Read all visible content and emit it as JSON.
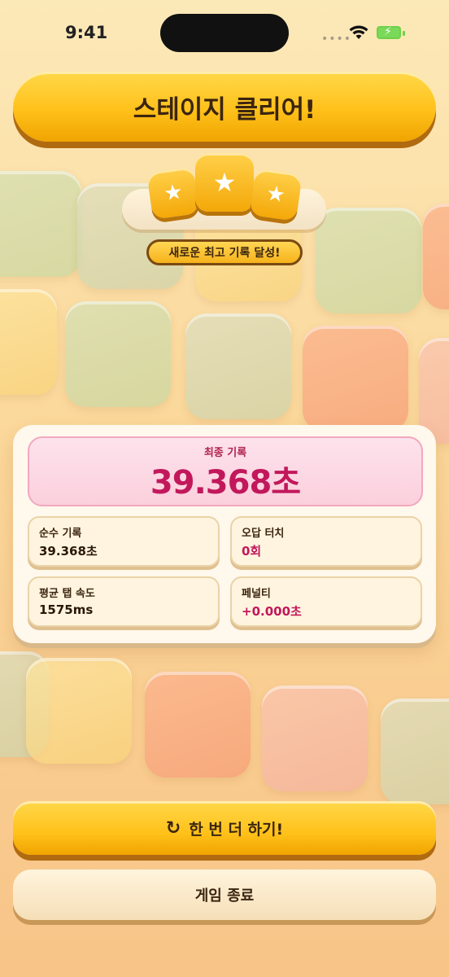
{
  "status": {
    "time": "9:41",
    "signal": "••••"
  },
  "banner": {
    "title": "스테이지 클리어!"
  },
  "stars": {
    "count": 3,
    "earned": 3,
    "glyph": "★"
  },
  "badge": {
    "text": "새로운 최고 기록 달성!"
  },
  "results": {
    "final_label": "최종 기록",
    "final_value": "39.368초",
    "stats": [
      {
        "label": "순수 기록",
        "value": "39.368초"
      },
      {
        "label": "오답 터치",
        "value": "0회"
      },
      {
        "label": "평균 탭 속도",
        "value": "1575ms"
      },
      {
        "label": "페널티",
        "value": "+0.000초"
      }
    ]
  },
  "actions": {
    "retry_label": "한 번 더 하기!",
    "retry_icon": "↻",
    "exit_label": "게임 종료"
  },
  "colors": {
    "accent_yellow": "#ffc11a",
    "accent_pink": "#c2185b",
    "text_brown": "#3b2510"
  }
}
